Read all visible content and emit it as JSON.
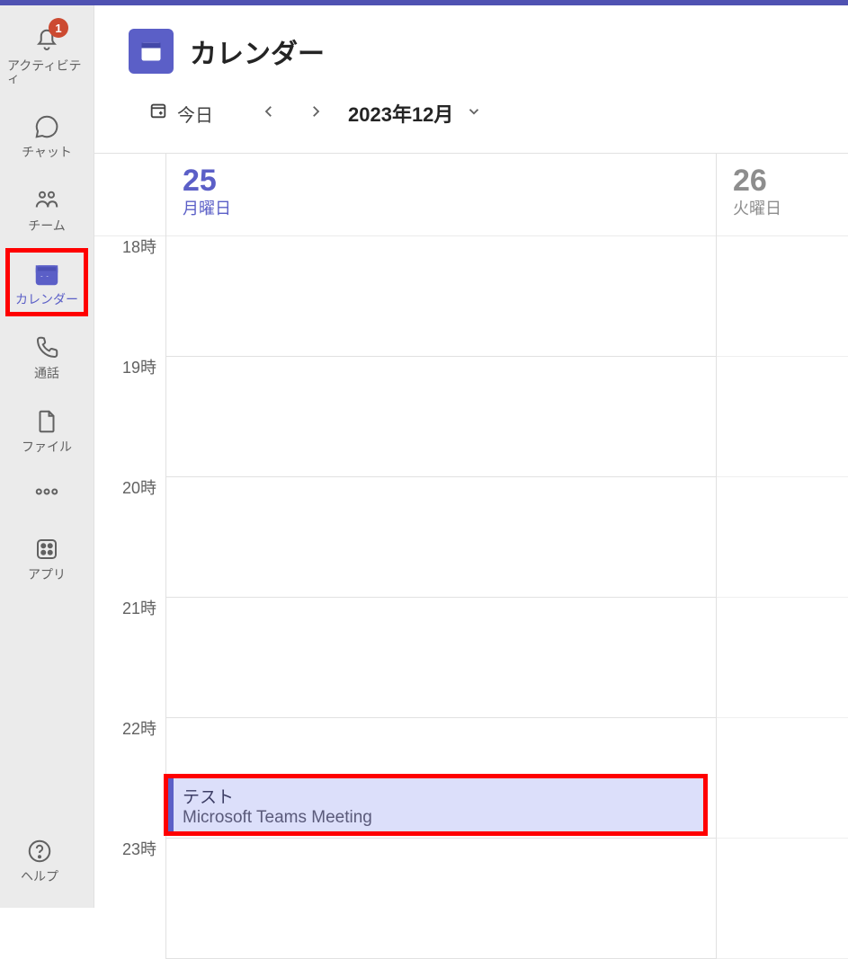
{
  "rail": {
    "items": [
      {
        "icon": "bell",
        "label": "アクティビティ",
        "badge": "1"
      },
      {
        "icon": "chat",
        "label": "チャット"
      },
      {
        "icon": "teams",
        "label": "チーム"
      },
      {
        "icon": "calendar",
        "label": "カレンダー",
        "active": true,
        "highlighted": true
      },
      {
        "icon": "call",
        "label": "通話"
      },
      {
        "icon": "file",
        "label": "ファイル"
      }
    ],
    "more_label": "",
    "apps_label": "アプリ",
    "help_label": "ヘルプ"
  },
  "header": {
    "title": "カレンダー"
  },
  "toolbar": {
    "today_label": "今日",
    "current_range": "2023年12月"
  },
  "calendar": {
    "hours": [
      "18時",
      "19時",
      "20時",
      "21時",
      "22時",
      "23時"
    ],
    "days": [
      {
        "num": "25",
        "name": "月曜日",
        "today": true
      },
      {
        "num": "26",
        "name": "火曜日",
        "today": false
      }
    ],
    "event": {
      "title": "テスト",
      "subtitle": "Microsoft Teams Meeting",
      "day_index": 0,
      "start_hour_index": 4,
      "offset_fraction": 0.5,
      "duration_fraction": 0.5
    }
  }
}
